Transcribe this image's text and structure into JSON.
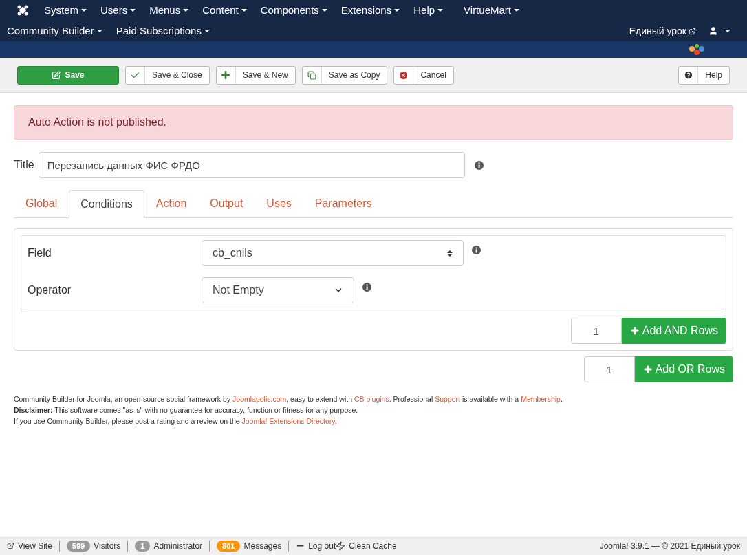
{
  "menu_rows": [
    [
      {
        "label": "System",
        "dropdown": true
      },
      {
        "label": "Users",
        "dropdown": true
      },
      {
        "label": "Menus",
        "dropdown": true
      },
      {
        "label": "Content",
        "dropdown": true
      },
      {
        "label": "Components",
        "dropdown": true
      },
      {
        "label": "Extensions",
        "dropdown": true
      },
      {
        "label": "Help",
        "dropdown": true
      },
      {
        "label": "VirtueMart",
        "dropdown": true
      }
    ],
    [
      {
        "label": "Community Builder",
        "dropdown": true
      },
      {
        "label": "Paid Subscriptions",
        "dropdown": true
      }
    ]
  ],
  "site_link": "Единый урок",
  "toolbar": [
    {
      "label": "Save",
      "kind": "primary"
    },
    {
      "label": "Save & Close",
      "kind": "default"
    },
    {
      "label": "Save & New",
      "kind": "default"
    },
    {
      "label": "Save as Copy",
      "kind": "default"
    },
    {
      "label": "Cancel",
      "kind": "default"
    }
  ],
  "help_button": "Help",
  "alert": "Auto Action is not published.",
  "title_field": {
    "label": "Title",
    "value": "Перезапись данных ФИС ФРДО"
  },
  "tabs": [
    {
      "label": "Global",
      "selected": false
    },
    {
      "label": "Conditions",
      "selected": true
    },
    {
      "label": "Action",
      "selected": false
    },
    {
      "label": "Output",
      "selected": false
    },
    {
      "label": "Uses",
      "selected": false
    },
    {
      "label": "Parameters",
      "selected": false
    }
  ],
  "conditions": [
    {
      "label": "Field",
      "value": "cb_cnils",
      "kind": "select-arrows"
    },
    {
      "label": "Operator",
      "value": "Not Empty",
      "kind": "dropdown"
    }
  ],
  "add_and": {
    "count": "1",
    "label": "Add AND Rows"
  },
  "add_or": {
    "count": "1",
    "label": "Add OR Rows"
  },
  "footer": [
    [
      {
        "kind": "text",
        "text": "Community Builder for Joomla, an open-source social framework by "
      },
      {
        "kind": "link",
        "text": "Joomlapolis.com"
      },
      {
        "kind": "text",
        "text": ", easy to extend with "
      },
      {
        "kind": "link",
        "text": "CB plugins"
      },
      {
        "kind": "text",
        "text": ". Professional "
      },
      {
        "kind": "link",
        "text": "Support"
      },
      {
        "kind": "text",
        "text": " is available with a "
      },
      {
        "kind": "link",
        "text": "Membership"
      },
      {
        "kind": "text",
        "text": "."
      }
    ],
    [
      {
        "kind": "bold",
        "text": "Disclaimer:"
      },
      {
        "kind": "text",
        "text": " This software comes \"as is\" with no guarantee for accuracy, function or fitness for any purpose."
      }
    ],
    [
      {
        "kind": "text",
        "text": "If you use Community Builder, please post a rating and a review on the "
      },
      {
        "kind": "link",
        "text": "Joomla! Extensions Directory"
      },
      {
        "kind": "text",
        "text": "."
      }
    ]
  ],
  "status_bar": {
    "items": [
      {
        "label": "View Site",
        "kind": "view"
      },
      {
        "label": "Visitors",
        "badge": "599",
        "color": "#999999",
        "kind": "badge"
      },
      {
        "label": "Administrator",
        "badge": "1",
        "color": "#999999",
        "kind": "badge"
      },
      {
        "label": "Messages",
        "badge": "801",
        "color": "#f89406",
        "kind": "badge"
      },
      {
        "label": "Log out",
        "kind": "logout"
      },
      {
        "label": "Clean Cache",
        "kind": "cache"
      }
    ],
    "version": "Joomla! 3.9.1 — © 2021 Единый урок"
  }
}
